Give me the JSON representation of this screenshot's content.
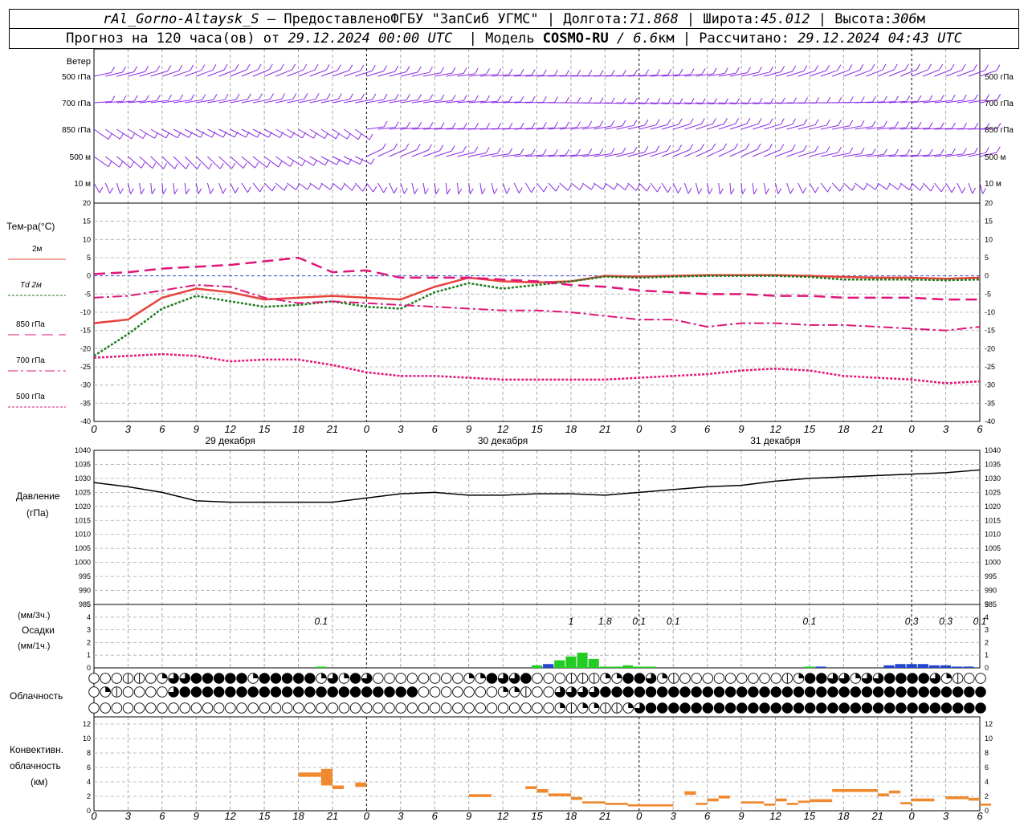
{
  "header": {
    "station": "rAl_Gorno-Altaysk_S",
    "dash": " — ",
    "provider_label": "Предоставлено",
    "provider": "ФГБУ \"ЗапСиб УГМС\"",
    "sep": " | ",
    "lon_label": "Долгота:",
    "lon": "71.868",
    "lat_label": "Широта:",
    "lat": "45.012",
    "alt_label": "Высота:",
    "alt": "306",
    "alt_unit": "м",
    "forecast_prefix": "Прогноз на 120 часа(ов) от ",
    "forecast_time": "29.12.2024 00:00 UTC",
    "model_label": "  | Модель ",
    "model": "COSMO-RU",
    "model_res": " / 6.6",
    "model_res_unit": "км",
    "calc_label": " | Рассчитано: ",
    "calc_time": "29.12.2024 04:43 UTC"
  },
  "axis": {
    "hour_ticks": [
      "0",
      "3",
      "6",
      "9",
      "12",
      "15",
      "18",
      "21",
      "0",
      "3",
      "6",
      "9",
      "12",
      "15",
      "18",
      "21",
      "0",
      "3",
      "6",
      "9",
      "12",
      "15",
      "18",
      "21",
      "0",
      "3",
      "6"
    ],
    "day_labels": [
      "29 декабря",
      "30 декабря",
      "31 декабря"
    ]
  },
  "labels": {
    "wind": "Ветер",
    "wind_levels": [
      "500 гПа",
      "700 гПа",
      "850 гПа",
      "500 м",
      "10  м"
    ],
    "temp": "Тем-ра(°C)",
    "legend": [
      {
        "text": "2м",
        "color": "#e8413a"
      },
      {
        "text": "Td  2м",
        "color": "#1f7a1f"
      },
      {
        "text": "850 гПа",
        "color": "#e0157a"
      },
      {
        "text": "700 гПа",
        "color": "#e0157a"
      },
      {
        "text": "500 гПа",
        "color": "#e0157a"
      }
    ],
    "pressure": "Давление",
    "pressure_unit": "(гПа)",
    "precip_unit1": "(мм/3ч.)",
    "precip": "Осадки",
    "precip_unit2": "(мм/1ч.)",
    "cloud": "Облачность",
    "conv1": "Конвективн.",
    "conv2": "облачность",
    "conv_unit": "(км)"
  },
  "colors": {
    "wind": "#8a2be2",
    "t2m": "#e8413a",
    "td2m": "#1f7a1f",
    "upper": "#e0157a",
    "pressure": "#000000",
    "precip_green": "#22cc22",
    "precip_blue": "#2244cc",
    "conv": "#f08a30"
  },
  "chart_data": [
    {
      "type": "line",
      "title": "Тем-ра(°C)",
      "x_label": "hours since 29.12.2024 00 UTC",
      "ylim": [
        -40,
        20
      ],
      "x": [
        0,
        3,
        6,
        9,
        12,
        15,
        18,
        21,
        24,
        27,
        30,
        33,
        36,
        39,
        42,
        45,
        48,
        51,
        54,
        57,
        60,
        63,
        66,
        69,
        72,
        75,
        78
      ],
      "series": [
        {
          "name": "2м",
          "values": [
            -13,
            -12,
            -6,
            -3.5,
            -4.5,
            -6.5,
            -6,
            -5.5,
            -6,
            -6.5,
            -3,
            -0.5,
            -1.5,
            -1.8,
            -1.5,
            0,
            -0.2,
            0,
            0.2,
            0.2,
            0.2,
            0,
            -0.3,
            -0.5,
            -0.5,
            -0.8,
            -0.5
          ]
        },
        {
          "name": "Td  2м",
          "values": [
            -22,
            -16,
            -9,
            -5.5,
            -7,
            -8.5,
            -8,
            -7,
            -8.5,
            -9,
            -4.5,
            -2,
            -3.5,
            -2.5,
            -1.5,
            -0.2,
            -0.5,
            -0.2,
            0,
            0,
            0,
            -0.3,
            -1,
            -1,
            -1,
            -1.2,
            -1
          ]
        },
        {
          "name": "850 гПа",
          "values": [
            0.5,
            1,
            2,
            2.5,
            3,
            4,
            5,
            1,
            1.5,
            -0.5,
            -0.5,
            -0.5,
            -1,
            -1.5,
            -2.5,
            -3,
            -4,
            -4.5,
            -5,
            -5,
            -5.5,
            -5.5,
            -6,
            -6,
            -6,
            -6.5,
            -6.5
          ]
        },
        {
          "name": "700 гПа",
          "values": [
            -6,
            -5.5,
            -4,
            -2.5,
            -3,
            -6,
            -7.5,
            -7,
            -7.5,
            -8,
            -8.5,
            -9,
            -9.5,
            -9.5,
            -10,
            -11,
            -12,
            -12,
            -14,
            -13,
            -13,
            -13.5,
            -13.5,
            -14,
            -14.5,
            -15,
            -14
          ]
        },
        {
          "name": "500 гПа",
          "values": [
            -22.5,
            -22,
            -21.5,
            -22,
            -23.5,
            -23,
            -23,
            -24.5,
            -26.5,
            -27.5,
            -27.5,
            -28,
            -28.5,
            -28.5,
            -28.5,
            -28.5,
            -28,
            -27.5,
            -27,
            -26,
            -25.5,
            -26,
            -27.5,
            -28,
            -28.5,
            -29.5,
            -29
          ]
        }
      ]
    },
    {
      "type": "line",
      "title": "Давление (гПа)",
      "ylim": [
        985,
        1040
      ],
      "x": [
        0,
        3,
        6,
        9,
        12,
        15,
        18,
        21,
        24,
        27,
        30,
        33,
        36,
        39,
        42,
        45,
        48,
        51,
        54,
        57,
        60,
        63,
        66,
        69,
        72,
        75,
        78
      ],
      "series": [
        {
          "name": "Давление",
          "values": [
            1028.5,
            1027,
            1025,
            1022,
            1021.5,
            1021.5,
            1021.5,
            1021.5,
            1023,
            1024.5,
            1025,
            1024,
            1024,
            1024.5,
            1024.5,
            1024,
            1025,
            1026,
            1027,
            1027.5,
            1029,
            1030,
            1030.5,
            1031,
            1031.5,
            1032,
            1033
          ]
        }
      ]
    },
    {
      "type": "bar",
      "title": "Осадки",
      "ylim": [
        0,
        5
      ],
      "totals_3h": [
        {
          "x": 20,
          "label": "0.1"
        },
        {
          "x": 42,
          "label": "1"
        },
        {
          "x": 45,
          "label": "1.8"
        },
        {
          "x": 48,
          "label": "0.1"
        },
        {
          "x": 51,
          "label": "0.1"
        },
        {
          "x": 63,
          "label": "0.1"
        },
        {
          "x": 72,
          "label": "0.3"
        },
        {
          "x": 75,
          "label": "0.3"
        },
        {
          "x": 78,
          "label": "0.1"
        }
      ],
      "hourly": [
        {
          "x": 20,
          "v": 0.1,
          "kind": "green"
        },
        {
          "x": 39,
          "v": 0.2,
          "kind": "green"
        },
        {
          "x": 40,
          "v": 0.3,
          "kind": "blue"
        },
        {
          "x": 41,
          "v": 0.6,
          "kind": "green"
        },
        {
          "x": 42,
          "v": 0.9,
          "kind": "green"
        },
        {
          "x": 43,
          "v": 1.2,
          "kind": "green"
        },
        {
          "x": 44,
          "v": 0.7,
          "kind": "green"
        },
        {
          "x": 45,
          "v": 0.1,
          "kind": "green"
        },
        {
          "x": 46,
          "v": 0.1,
          "kind": "green"
        },
        {
          "x": 47,
          "v": 0.2,
          "kind": "green"
        },
        {
          "x": 48,
          "v": 0.1,
          "kind": "green"
        },
        {
          "x": 49,
          "v": 0.1,
          "kind": "green"
        },
        {
          "x": 63,
          "v": 0.1,
          "kind": "green"
        },
        {
          "x": 64,
          "v": 0.1,
          "kind": "blue"
        },
        {
          "x": 70,
          "v": 0.2,
          "kind": "blue"
        },
        {
          "x": 71,
          "v": 0.3,
          "kind": "blue"
        },
        {
          "x": 72,
          "v": 0.3,
          "kind": "blue"
        },
        {
          "x": 73,
          "v": 0.3,
          "kind": "blue"
        },
        {
          "x": 74,
          "v": 0.2,
          "kind": "blue"
        },
        {
          "x": 75,
          "v": 0.2,
          "kind": "blue"
        },
        {
          "x": 76,
          "v": 0.1,
          "kind": "blue"
        },
        {
          "x": 77,
          "v": 0.1,
          "kind": "blue"
        }
      ]
    },
    {
      "type": "table",
      "title": "Облачность",
      "rows": [
        {
          "name": "upper",
          "values": [
            0,
            0,
            0,
            1,
            1,
            0,
            2,
            3,
            3,
            4,
            4,
            4,
            4,
            4,
            2,
            4,
            4,
            4,
            4,
            4,
            2,
            3,
            2,
            4,
            3,
            0,
            0,
            0,
            0,
            0,
            0,
            0,
            0,
            2,
            2,
            4,
            3,
            3,
            4,
            0,
            0,
            0,
            1,
            1,
            1,
            2,
            2,
            4,
            4,
            3,
            2,
            1,
            0,
            0,
            0,
            0,
            0,
            0,
            0,
            0,
            0,
            1,
            2,
            4,
            4,
            3,
            3,
            2,
            3,
            3,
            4,
            4,
            4,
            4,
            3,
            2,
            1,
            0,
            0
          ]
        },
        {
          "name": "middle",
          "values": [
            0,
            2,
            1,
            0,
            0,
            0,
            0,
            3,
            4,
            4,
            4,
            4,
            4,
            4,
            4,
            4,
            4,
            4,
            4,
            4,
            4,
            4,
            4,
            4,
            4,
            4,
            4,
            4,
            4,
            0,
            0,
            0,
            0,
            0,
            0,
            0,
            2,
            2,
            1,
            0,
            0,
            3,
            3,
            3,
            3,
            4,
            4,
            4,
            4,
            4,
            4,
            4,
            4,
            4,
            4,
            4,
            4,
            4,
            4,
            4,
            4,
            4,
            4,
            4,
            4,
            4,
            4,
            4,
            4,
            4,
            4,
            4,
            4,
            4,
            4,
            4,
            4,
            4,
            4
          ]
        },
        {
          "name": "lower",
          "values": [
            0,
            0,
            0,
            0,
            0,
            0,
            0,
            0,
            0,
            0,
            0,
            0,
            0,
            0,
            0,
            0,
            0,
            0,
            0,
            0,
            0,
            0,
            0,
            0,
            0,
            0,
            0,
            0,
            0,
            0,
            0,
            0,
            0,
            0,
            0,
            0,
            0,
            0,
            0,
            0,
            0,
            2,
            1,
            2,
            2,
            1,
            1,
            2,
            3,
            4,
            4,
            4,
            4,
            4,
            4,
            4,
            4,
            4,
            4,
            4,
            4,
            4,
            4,
            4,
            4,
            4,
            4,
            4,
            4,
            4,
            4,
            4,
            4,
            4,
            4,
            4,
            4,
            4,
            4
          ]
        }
      ]
    },
    {
      "type": "bar",
      "title": "Конвективн. облачность (км)",
      "ylim": [
        0,
        13
      ],
      "segments": [
        {
          "x0": 18,
          "x1": 20,
          "bottom": 4.7,
          "top": 5.3
        },
        {
          "x0": 20,
          "x1": 21,
          "bottom": 3.5,
          "top": 5.8
        },
        {
          "x0": 21,
          "x1": 22,
          "bottom": 3.0,
          "top": 3.5
        },
        {
          "x0": 23,
          "x1": 24,
          "bottom": 3.3,
          "top": 3.9
        },
        {
          "x0": 33,
          "x1": 35,
          "bottom": 1.9,
          "top": 2.3
        },
        {
          "x0": 38,
          "x1": 39,
          "bottom": 3.0,
          "top": 3.4
        },
        {
          "x0": 39,
          "x1": 40,
          "bottom": 2.5,
          "top": 3.0
        },
        {
          "x0": 40,
          "x1": 42,
          "bottom": 2.0,
          "top": 2.4
        },
        {
          "x0": 42,
          "x1": 43,
          "bottom": 1.5,
          "top": 1.9
        },
        {
          "x0": 43,
          "x1": 45,
          "bottom": 1.0,
          "top": 1.3
        },
        {
          "x0": 45,
          "x1": 47,
          "bottom": 0.8,
          "top": 1.1
        },
        {
          "x0": 47,
          "x1": 50,
          "bottom": 0.6,
          "top": 0.9
        },
        {
          "x0": 50,
          "x1": 51,
          "bottom": 0.6,
          "top": 0.9
        },
        {
          "x0": 52,
          "x1": 53,
          "bottom": 2.2,
          "top": 2.7
        },
        {
          "x0": 53,
          "x1": 54,
          "bottom": 0.8,
          "top": 1.1
        },
        {
          "x0": 54,
          "x1": 55,
          "bottom": 1.3,
          "top": 1.7
        },
        {
          "x0": 55,
          "x1": 56,
          "bottom": 1.7,
          "top": 2.1
        },
        {
          "x0": 57,
          "x1": 59,
          "bottom": 1.0,
          "top": 1.3
        },
        {
          "x0": 59,
          "x1": 60,
          "bottom": 0.7,
          "top": 1.0
        },
        {
          "x0": 60,
          "x1": 61,
          "bottom": 1.3,
          "top": 1.7
        },
        {
          "x0": 61,
          "x1": 62,
          "bottom": 0.8,
          "top": 1.1
        },
        {
          "x0": 62,
          "x1": 63,
          "bottom": 1.1,
          "top": 1.4
        },
        {
          "x0": 63,
          "x1": 65,
          "bottom": 1.2,
          "top": 1.6
        },
        {
          "x0": 65,
          "x1": 69,
          "bottom": 2.6,
          "top": 3.0
        },
        {
          "x0": 69,
          "x1": 70,
          "bottom": 2.0,
          "top": 2.4
        },
        {
          "x0": 70,
          "x1": 71,
          "bottom": 2.4,
          "top": 2.8
        },
        {
          "x0": 71,
          "x1": 72,
          "bottom": 0.9,
          "top": 1.2
        },
        {
          "x0": 72,
          "x1": 74,
          "bottom": 1.3,
          "top": 1.7
        },
        {
          "x0": 75,
          "x1": 77,
          "bottom": 1.6,
          "top": 2.0
        },
        {
          "x0": 77,
          "x1": 78,
          "bottom": 1.4,
          "top": 1.8
        },
        {
          "x0": 78,
          "x1": 79,
          "bottom": 0.7,
          "top": 1.0
        }
      ]
    }
  ]
}
